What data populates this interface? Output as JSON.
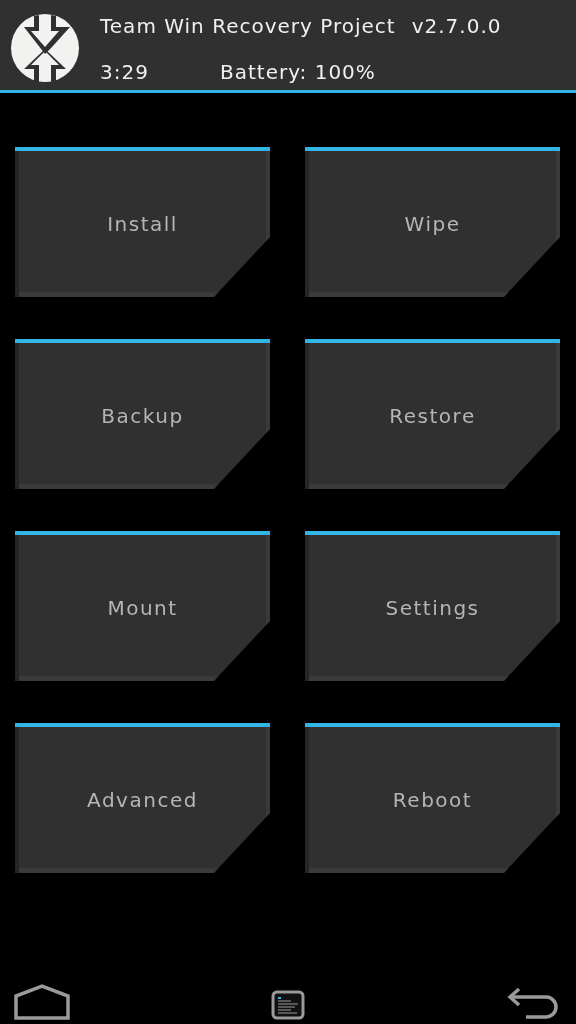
{
  "header": {
    "title": "Team Win Recovery Project",
    "version": "v2.7.0.0",
    "time": "3:29",
    "battery": "Battery: 100%"
  },
  "buttons": [
    {
      "label": "Install"
    },
    {
      "label": "Wipe"
    },
    {
      "label": "Backup"
    },
    {
      "label": "Restore"
    },
    {
      "label": "Mount"
    },
    {
      "label": "Settings"
    },
    {
      "label": "Advanced"
    },
    {
      "label": "Reboot"
    }
  ]
}
